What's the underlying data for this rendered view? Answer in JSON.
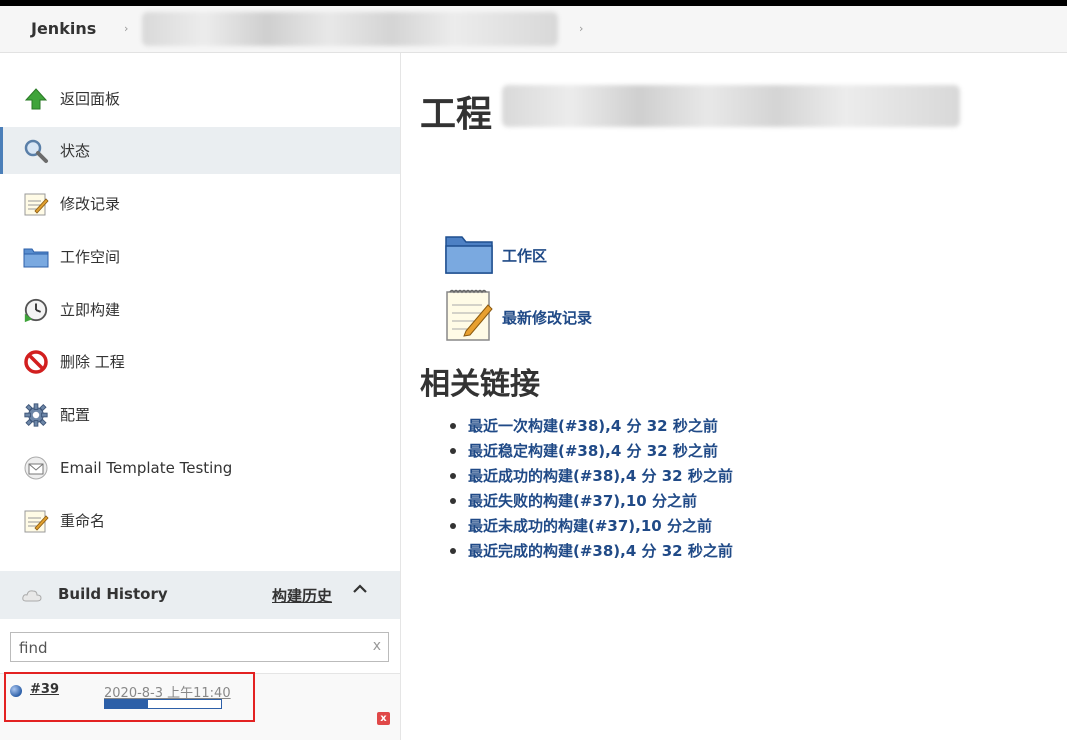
{
  "breadcrumb": {
    "root": "Jenkins",
    "separator": "›"
  },
  "sidebar": {
    "tasks": [
      {
        "label": "返回面板",
        "icon": "up-arrow-icon"
      },
      {
        "label": "状态",
        "icon": "search-icon"
      },
      {
        "label": "修改记录",
        "icon": "notepad-icon"
      },
      {
        "label": "工作空间",
        "icon": "folder-icon"
      },
      {
        "label": "立即构建",
        "icon": "clock-icon"
      },
      {
        "label": "删除 工程",
        "icon": "no-entry-icon"
      },
      {
        "label": "配置",
        "icon": "gear-icon"
      },
      {
        "label": "Email Template Testing",
        "icon": "envelope-icon"
      },
      {
        "label": "重命名",
        "icon": "notepad-icon"
      }
    ],
    "active_index": 1
  },
  "build_history": {
    "title": "Build History",
    "trend_label": "构建历史",
    "toggle": "^",
    "find_value": "find",
    "find_clear": "x",
    "builds": [
      {
        "number": "#39",
        "time": "2020-8-3 上午11:40",
        "progress": 0.37,
        "status_color": "#2c5fa8"
      }
    ]
  },
  "main": {
    "title_prefix": "工程",
    "links": [
      {
        "label": "工作区",
        "icon": "folder-icon"
      },
      {
        "label": "最新修改记录",
        "icon": "notepad-icon"
      }
    ],
    "permalinks_title": "相关链接",
    "permalinks": [
      "最近一次构建(#38),4 分 32 秒之前",
      "最近稳定构建(#38),4 分 32 秒之前",
      "最近成功的构建(#38),4 分 32 秒之前",
      "最近失败的构建(#37),10 分之前",
      "最近未成功的构建(#37),10 分之前",
      "最近完成的构建(#38),4 分 32 秒之前"
    ]
  },
  "colors": {
    "link": "#204a87",
    "active_bg": "#eaeef1",
    "highlight": "#e32222"
  }
}
